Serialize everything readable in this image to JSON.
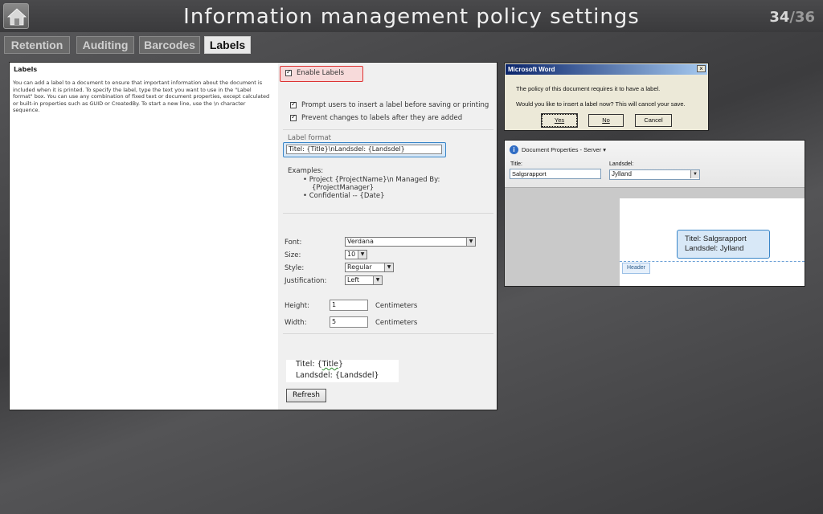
{
  "slide": {
    "title": "Information management policy settings",
    "page_current": "34",
    "page_total": "/36"
  },
  "tabs": [
    {
      "label": "Retention",
      "active": false
    },
    {
      "label": "Auditing",
      "active": false
    },
    {
      "label": "Barcodes",
      "active": false
    },
    {
      "label": "Labels",
      "active": true
    }
  ],
  "labels_panel": {
    "heading": "Labels",
    "description": "You can add a label to a document to ensure that important information about the document is included when it is printed. To specify the label, type the text you want to use in the \"Label format\" box. You can use any combination of fixed text or document properties, except calculated or built-in properties such as GUID or CreatedBy. To start a new line, use the \\n character sequence.",
    "enable_labels": "Enable Labels",
    "prompt_users": "Prompt users to insert a label before saving or printing",
    "prevent_changes": "Prevent changes to labels after they are added",
    "label_format_title": "Label format",
    "label_format_value": "Titel: {Title}\\nLandsdel: {Landsdel}",
    "examples_title": "Examples:",
    "example_1a": "Project {ProjectName}\\n Managed By:",
    "example_1b": "{ProjectManager}",
    "example_2": "Confidential -- {Date}",
    "font_label": "Font:",
    "font_value": "Verdana",
    "size_label": "Size:",
    "size_value": "10",
    "style_label": "Style:",
    "style_value": "Regular",
    "justification_label": "Justification:",
    "justification_value": "Left",
    "height_label": "Height:",
    "height_value": "1",
    "width_label": "Width:",
    "width_value": "5",
    "unit": "Centimeters",
    "preview_prefix": "Titel: {",
    "preview_title_token": "Title",
    "preview_suffix": "}",
    "preview_line2": "Landsdel: {Landsdel}",
    "refresh_button": "Refresh"
  },
  "word_dialog": {
    "title": "Microsoft Word",
    "close": "×",
    "message_1": "The policy of this document requires it to have a label.",
    "message_2": "Would you like to insert a label now? This will cancel your save.",
    "yes": "Yes",
    "no": "No",
    "cancel": "Cancel"
  },
  "document_properties": {
    "title": "Document Properties - Server",
    "title_label": "Title:",
    "title_value": "Salgsrapport",
    "landsdel_label": "Landsdel:",
    "landsdel_value": "Jylland",
    "label_line1": "Titel: Salgsrapport",
    "label_line2": "Landsdel: Jylland",
    "header_tag": "Header"
  },
  "colors": {
    "highlight_red": "#d33333",
    "highlight_blue": "#3a86c8",
    "dialog_title_bar": "#0a246a"
  }
}
